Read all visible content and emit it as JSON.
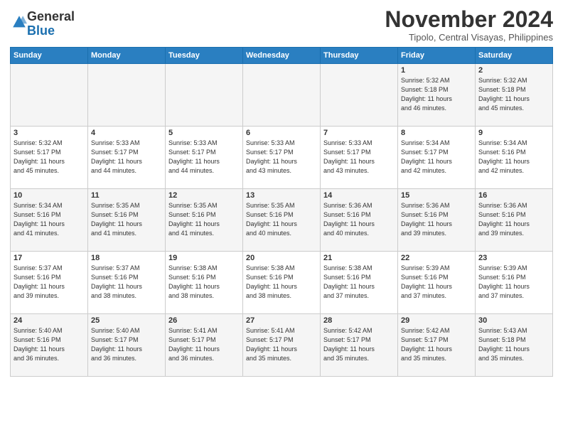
{
  "logo": {
    "line1": "General",
    "line2": "Blue"
  },
  "header": {
    "month": "November 2024",
    "location": "Tipolo, Central Visayas, Philippines"
  },
  "weekdays": [
    "Sunday",
    "Monday",
    "Tuesday",
    "Wednesday",
    "Thursday",
    "Friday",
    "Saturday"
  ],
  "weeks": [
    [
      {
        "day": "",
        "info": ""
      },
      {
        "day": "",
        "info": ""
      },
      {
        "day": "",
        "info": ""
      },
      {
        "day": "",
        "info": ""
      },
      {
        "day": "",
        "info": ""
      },
      {
        "day": "1",
        "info": "Sunrise: 5:32 AM\nSunset: 5:18 PM\nDaylight: 11 hours\nand 46 minutes."
      },
      {
        "day": "2",
        "info": "Sunrise: 5:32 AM\nSunset: 5:18 PM\nDaylight: 11 hours\nand 45 minutes."
      }
    ],
    [
      {
        "day": "3",
        "info": "Sunrise: 5:32 AM\nSunset: 5:17 PM\nDaylight: 11 hours\nand 45 minutes."
      },
      {
        "day": "4",
        "info": "Sunrise: 5:33 AM\nSunset: 5:17 PM\nDaylight: 11 hours\nand 44 minutes."
      },
      {
        "day": "5",
        "info": "Sunrise: 5:33 AM\nSunset: 5:17 PM\nDaylight: 11 hours\nand 44 minutes."
      },
      {
        "day": "6",
        "info": "Sunrise: 5:33 AM\nSunset: 5:17 PM\nDaylight: 11 hours\nand 43 minutes."
      },
      {
        "day": "7",
        "info": "Sunrise: 5:33 AM\nSunset: 5:17 PM\nDaylight: 11 hours\nand 43 minutes."
      },
      {
        "day": "8",
        "info": "Sunrise: 5:34 AM\nSunset: 5:17 PM\nDaylight: 11 hours\nand 42 minutes."
      },
      {
        "day": "9",
        "info": "Sunrise: 5:34 AM\nSunset: 5:16 PM\nDaylight: 11 hours\nand 42 minutes."
      }
    ],
    [
      {
        "day": "10",
        "info": "Sunrise: 5:34 AM\nSunset: 5:16 PM\nDaylight: 11 hours\nand 41 minutes."
      },
      {
        "day": "11",
        "info": "Sunrise: 5:35 AM\nSunset: 5:16 PM\nDaylight: 11 hours\nand 41 minutes."
      },
      {
        "day": "12",
        "info": "Sunrise: 5:35 AM\nSunset: 5:16 PM\nDaylight: 11 hours\nand 41 minutes."
      },
      {
        "day": "13",
        "info": "Sunrise: 5:35 AM\nSunset: 5:16 PM\nDaylight: 11 hours\nand 40 minutes."
      },
      {
        "day": "14",
        "info": "Sunrise: 5:36 AM\nSunset: 5:16 PM\nDaylight: 11 hours\nand 40 minutes."
      },
      {
        "day": "15",
        "info": "Sunrise: 5:36 AM\nSunset: 5:16 PM\nDaylight: 11 hours\nand 39 minutes."
      },
      {
        "day": "16",
        "info": "Sunrise: 5:36 AM\nSunset: 5:16 PM\nDaylight: 11 hours\nand 39 minutes."
      }
    ],
    [
      {
        "day": "17",
        "info": "Sunrise: 5:37 AM\nSunset: 5:16 PM\nDaylight: 11 hours\nand 39 minutes."
      },
      {
        "day": "18",
        "info": "Sunrise: 5:37 AM\nSunset: 5:16 PM\nDaylight: 11 hours\nand 38 minutes."
      },
      {
        "day": "19",
        "info": "Sunrise: 5:38 AM\nSunset: 5:16 PM\nDaylight: 11 hours\nand 38 minutes."
      },
      {
        "day": "20",
        "info": "Sunrise: 5:38 AM\nSunset: 5:16 PM\nDaylight: 11 hours\nand 38 minutes."
      },
      {
        "day": "21",
        "info": "Sunrise: 5:38 AM\nSunset: 5:16 PM\nDaylight: 11 hours\nand 37 minutes."
      },
      {
        "day": "22",
        "info": "Sunrise: 5:39 AM\nSunset: 5:16 PM\nDaylight: 11 hours\nand 37 minutes."
      },
      {
        "day": "23",
        "info": "Sunrise: 5:39 AM\nSunset: 5:16 PM\nDaylight: 11 hours\nand 37 minutes."
      }
    ],
    [
      {
        "day": "24",
        "info": "Sunrise: 5:40 AM\nSunset: 5:16 PM\nDaylight: 11 hours\nand 36 minutes."
      },
      {
        "day": "25",
        "info": "Sunrise: 5:40 AM\nSunset: 5:17 PM\nDaylight: 11 hours\nand 36 minutes."
      },
      {
        "day": "26",
        "info": "Sunrise: 5:41 AM\nSunset: 5:17 PM\nDaylight: 11 hours\nand 36 minutes."
      },
      {
        "day": "27",
        "info": "Sunrise: 5:41 AM\nSunset: 5:17 PM\nDaylight: 11 hours\nand 35 minutes."
      },
      {
        "day": "28",
        "info": "Sunrise: 5:42 AM\nSunset: 5:17 PM\nDaylight: 11 hours\nand 35 minutes."
      },
      {
        "day": "29",
        "info": "Sunrise: 5:42 AM\nSunset: 5:17 PM\nDaylight: 11 hours\nand 35 minutes."
      },
      {
        "day": "30",
        "info": "Sunrise: 5:43 AM\nSunset: 5:18 PM\nDaylight: 11 hours\nand 35 minutes."
      }
    ]
  ]
}
